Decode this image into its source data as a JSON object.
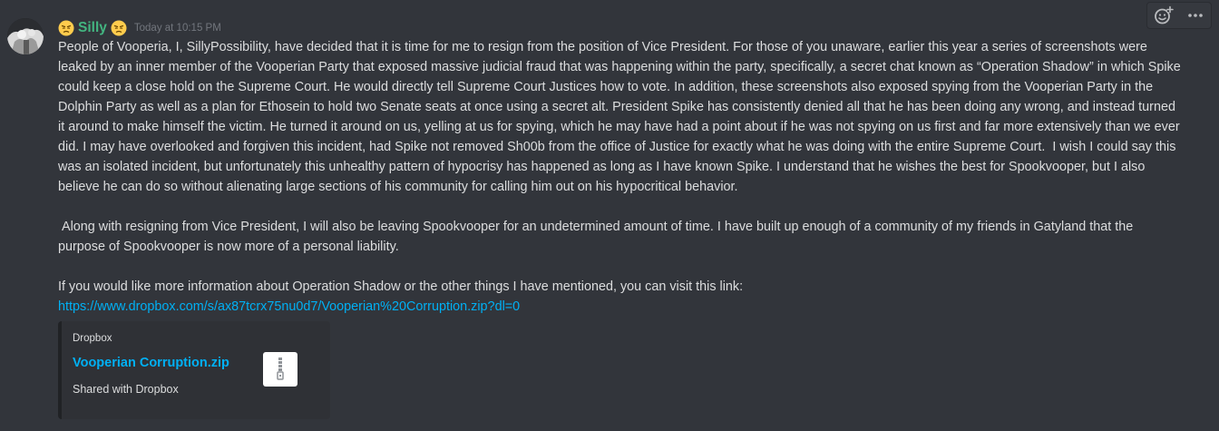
{
  "message": {
    "author": "Silly",
    "author_color": "#43b581",
    "author_emoji_icon": "disappointed-relieved-face-icon",
    "timestamp": "Today at 10:15 PM",
    "paragraphs": [
      "People of Vooperia, I, SillyPossibility, have decided that it is time for me to resign from the position of Vice President. For those of you unaware, earlier this year a series of screenshots were leaked by an inner member of the Vooperian Party that exposed massive judicial fraud that was happening within the party, specifically, a secret chat known as “Operation Shadow” in which Spike could keep a close hold on the Supreme Court. He would directly tell Supreme Court Justices how to vote. In addition, these screenshots also exposed spying from the Vooperian Party in the Dolphin Party as well as a plan for Ethosein to hold two Senate seats at once using a secret alt. President Spike has consistently denied all that he has been doing any wrong, and instead turned it around to make himself the victim. He turned it around on us, yelling at us for spying, which he may have had a point about if he was not spying on us first and far more extensively than we ever did. I may have overlooked and forgiven this incident, had Spike not removed Sh00b from the office of Justice for exactly what he was doing with the entire Supreme Court.  I wish I could say this was an isolated incident, but unfortunately this unhealthy pattern of hypocrisy has happened as long as I have known Spike. I understand that he wishes the best for Spookvooper, but I also believe he can do so without alienating large sections of his community for calling him out on his hypocritical behavior.",
      " Along with resigning from Vice President, I will also be leaving Spookvooper for an undetermined amount of time. I have built up enough of a community of my friends in Gatyland that the purpose of Spookvooper is now more of a personal liability.",
      "If you would like more information about Operation Shadow or the other things I have mentioned, you can visit this link:"
    ],
    "link": "https://www.dropbox.com/s/ax87tcrx75nu0d7/Vooperian%20Corruption.zip?dl=0",
    "link_color": "#00b0f4"
  },
  "embed": {
    "provider": "Dropbox",
    "title": "Vooperian Corruption.zip",
    "description": "Shared with Dropbox",
    "thumbnail_icon": "zip-file-icon"
  },
  "toolbar": {
    "icons": [
      "add-reaction-icon",
      "more-options-icon"
    ]
  },
  "colors": {
    "background": "#32353b",
    "text": "#dcddde",
    "muted": "#72767d"
  }
}
